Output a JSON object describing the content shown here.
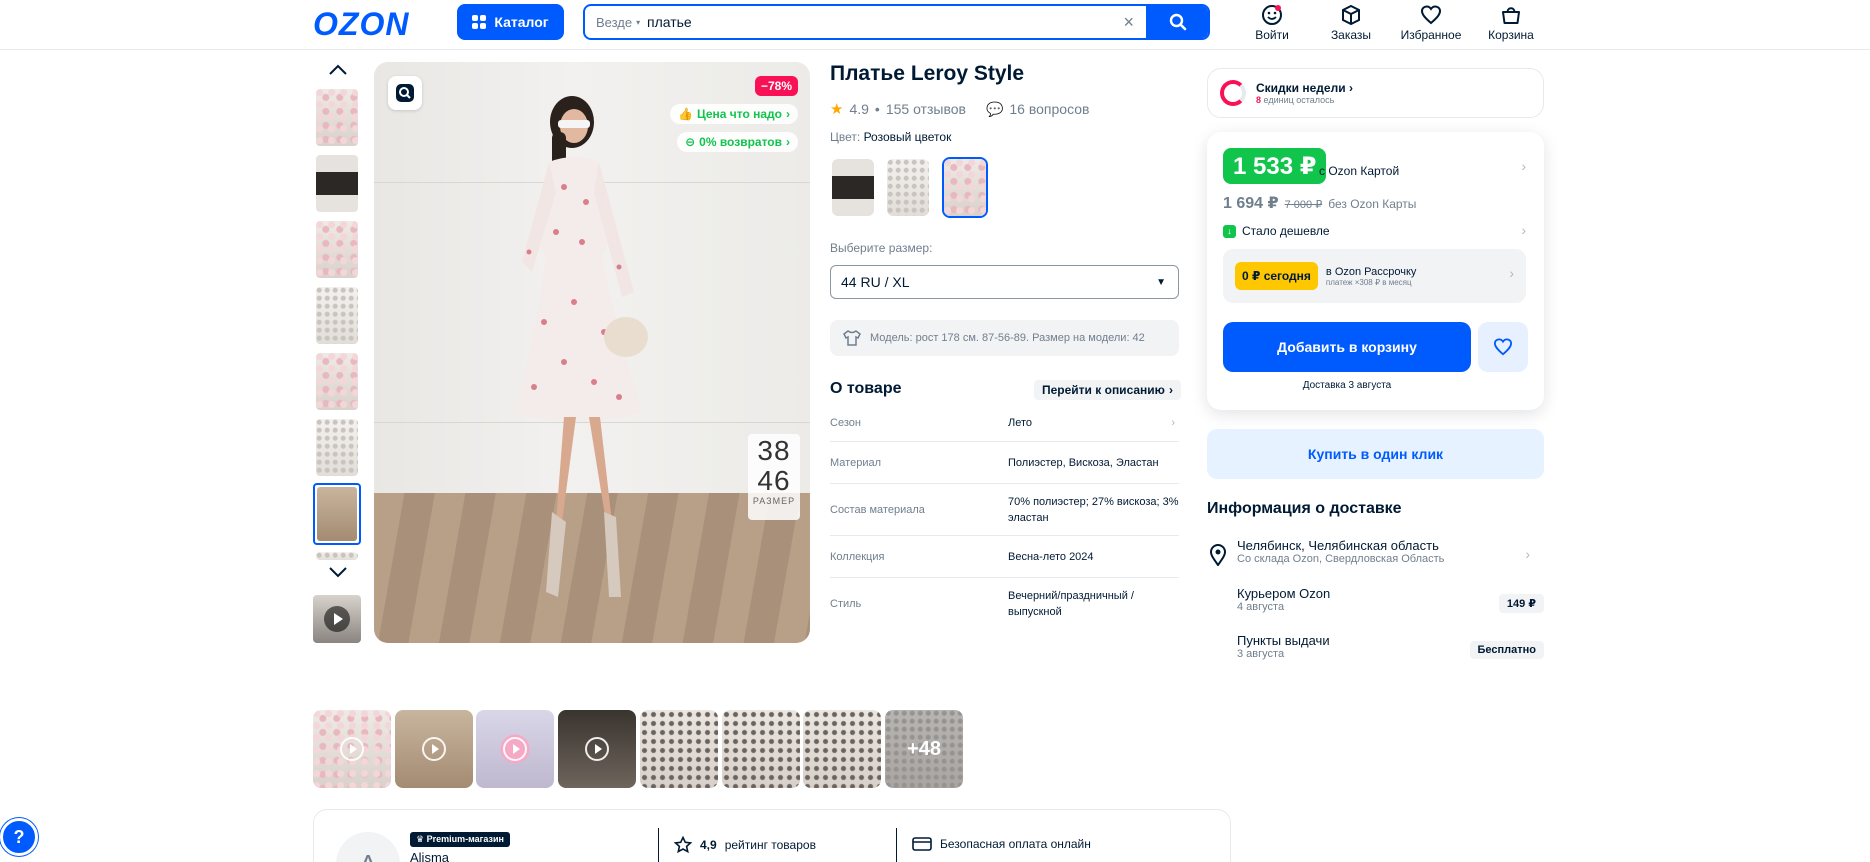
{
  "header": {
    "logo": "OZON",
    "catalog_label": "Каталог",
    "search_scope": "Везде",
    "search_value": "платье",
    "nav": [
      {
        "label": "Войти",
        "icon": "user-icon"
      },
      {
        "label": "Заказы",
        "icon": "box-icon"
      },
      {
        "label": "Избранное",
        "icon": "heart-icon"
      },
      {
        "label": "Корзина",
        "icon": "cart-icon"
      }
    ]
  },
  "gallery_main": {
    "discount": "−78%",
    "tags": [
      "Цена что надо",
      "0% возвратов"
    ],
    "size_badge": {
      "top": "38",
      "bottom": "46",
      "label": "РАЗМЕР"
    }
  },
  "product": {
    "title": "Платье Leroy Style",
    "rating": "4.9",
    "reviews": "155 отзывов",
    "questions": "16 вопросов",
    "color_label": "Цвет:",
    "color_value": "Розовый цветок",
    "size_label": "Выберите размер:",
    "size_value": "44 RU / XL",
    "model_info": "Модель: рост 178 см. 87-56-89. Размер на модели: 42",
    "about_title": "О товаре",
    "goto_description": "Перейти к описанию",
    "specs": [
      {
        "key": "Сезон",
        "value": "Лето"
      },
      {
        "key": "Материал",
        "value": "Полиэстер, Вискоза, Эластан"
      },
      {
        "key": "Состав материала",
        "value": "70% полиэстер; 27% вискоза; 3% эластан"
      },
      {
        "key": "Коллекция",
        "value": "Весна-лето 2024"
      },
      {
        "key": "Стиль",
        "value": "Вечерний/праздничный /выпускной"
      }
    ]
  },
  "buy_box": {
    "deals_title": "Скидки недели",
    "deals_count": "8",
    "deals_suffix": "единиц осталось",
    "price_card": "1 533 ₽",
    "price_card_note": "с Ozon Картой",
    "price_regular": "1 694 ₽",
    "price_old": "7 000 ₽",
    "price_regular_note": "без Ozon Карты",
    "cheaper_label": "Стало дешевле",
    "installment_badge": "0 ₽ сегодня",
    "installment_title": "в Ozon Рассрочку",
    "installment_sub": "платеж ×308 ₽ в месяц",
    "add_to_cart": "Добавить в корзину",
    "delivery_date": "Доставка 3 августа",
    "one_click": "Купить в один клик"
  },
  "delivery": {
    "title": "Информация о доставке",
    "location": "Челябинск, Челябинская область",
    "location_sub": "Со склада Ozon, Свердловская Область",
    "options": [
      {
        "name": "Курьером Ozon",
        "date": "4 августа",
        "price": "149 ₽"
      },
      {
        "name": "Пункты выдачи",
        "date": "3 августа",
        "price": "Бесплатно"
      }
    ]
  },
  "media_strip": {
    "more_label": "+48"
  },
  "seller": {
    "avatar_letter": "A",
    "badge": "Premium-магазин",
    "name": "Alisma",
    "rating": "4,9",
    "rating_label": "рейтинг товаров",
    "payment_label": "Безопасная оплата онлайн"
  },
  "help_label": "?",
  "colors": {
    "accent": "#005bff",
    "discount": "#f91155",
    "green": "#10c44c",
    "installment": "#ffc700"
  }
}
